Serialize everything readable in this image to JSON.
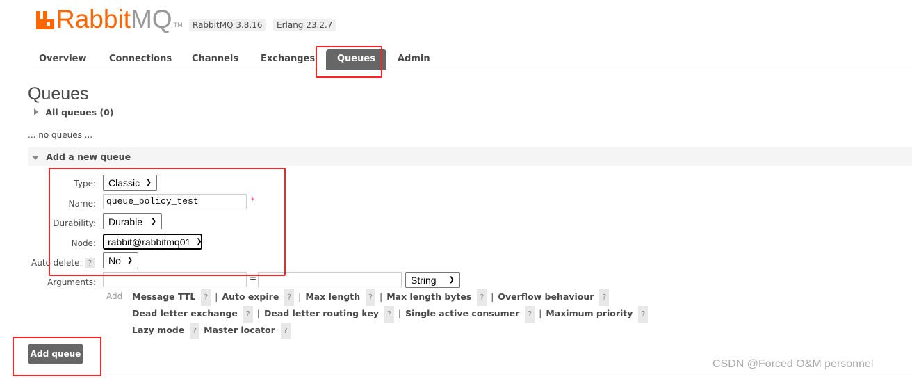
{
  "header": {
    "logo_text": [
      "Rabbit",
      "MQ"
    ],
    "trademark": "TM",
    "version_badge": "RabbitMQ 3.8.16",
    "erlang_badge": "Erlang 23.2.7",
    "brand_color": "#ff6600"
  },
  "nav": {
    "tabs": [
      "Overview",
      "Connections",
      "Channels",
      "Exchanges",
      "Queues",
      "Admin"
    ],
    "active": "Queues"
  },
  "page": {
    "title": "Queues",
    "all_queues": "All queues (0)",
    "no_queues": "... no queues ...",
    "add_section": "Add a new queue"
  },
  "form": {
    "type_label": "Type:",
    "type_value": "Classic",
    "name_label": "Name:",
    "name_value": "queue_policy_test",
    "required_mark": "*",
    "durability_label": "Durability:",
    "durability_value": "Durable",
    "node_label": "Node:",
    "node_value": "rabbit@rabbitmq01",
    "auto_delete_label": "Auto delete:",
    "auto_delete_value": "No",
    "help": "?",
    "arguments_label": "Arguments:",
    "equals": "=",
    "arg_type_value": "String",
    "add_label": "Add",
    "arg_rows": [
      [
        "Message TTL",
        "Auto expire",
        "Max length",
        "Max length bytes",
        "Overflow behaviour"
      ],
      [
        "Dead letter exchange",
        "Dead letter routing key",
        "Single active consumer",
        "Maximum priority"
      ],
      [
        "Lazy mode",
        "Master locator"
      ]
    ],
    "submit": "Add queue"
  },
  "watermark": "CSDN @Forced O&M personnel",
  "annotation_color": "#ff2222"
}
